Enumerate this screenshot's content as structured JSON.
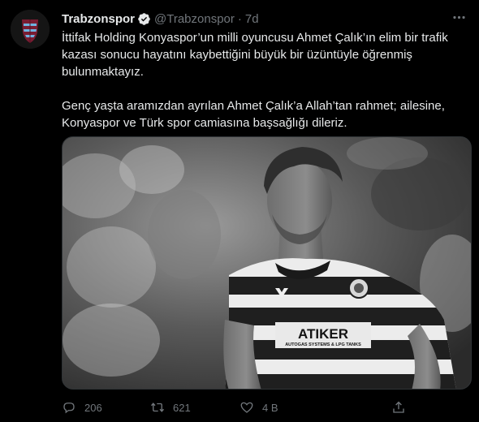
{
  "tweet": {
    "author": {
      "display_name": "Trabzonspor",
      "handle": "@Trabzonspor",
      "verified": true,
      "avatar_icon": "club-crest-icon"
    },
    "separator": "·",
    "timestamp": "7d",
    "paragraphs": [
      "İttifak Holding Konyaspor’un milli oyuncusu Ahmet Çalık’ın elim bir trafik kazası sonucu hayatını kaybettiğini büyük bir üzüntüyle öğrenmiş bulunmaktayız.",
      "Genç yaşta aramızdan ayrılan Ahmet Çalık’a Allah’tan rahmet; ailesine, Konyaspor ve Türk spor camiasına başsağlığı dileriz."
    ],
    "media": {
      "sponsor_text": "ATIKER",
      "sponsor_subtext": "AUTOGAS SYSTEMS & LPG TANKS"
    },
    "actions": {
      "reply_count": "206",
      "retweet_count": "621",
      "like_count": "4 B",
      "reply_icon": "reply-icon",
      "retweet_icon": "retweet-icon",
      "like_icon": "heart-icon",
      "share_icon": "share-icon"
    }
  },
  "colors": {
    "background": "#000000",
    "text": "#e7e9ea",
    "muted": "#71767b",
    "verified": "#1d9bf0",
    "crest_maroon": "#7a1c32",
    "crest_blue": "#6fb3e0"
  }
}
